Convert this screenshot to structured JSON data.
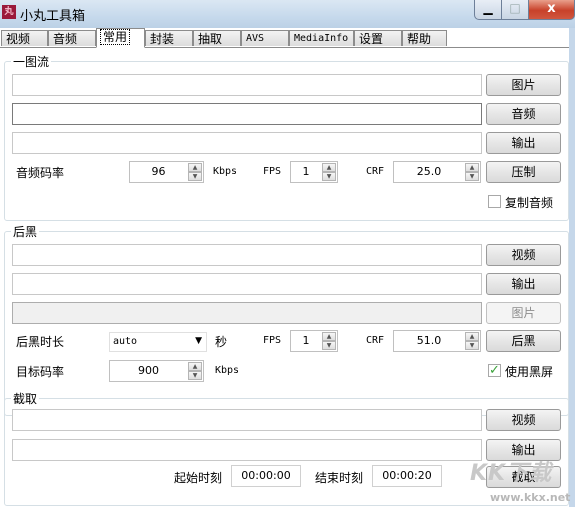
{
  "window": {
    "title": "小丸工具箱",
    "app_icon_glyph": "丸",
    "controls": {
      "minimize": "▁",
      "maximize": "□",
      "close": "x"
    }
  },
  "tabs": [
    {
      "label": "视频",
      "active": false
    },
    {
      "label": "音频",
      "active": false
    },
    {
      "label": "常用",
      "active": true
    },
    {
      "label": "封装",
      "active": false
    },
    {
      "label": "抽取",
      "active": false
    },
    {
      "label": "AVS",
      "active": false
    },
    {
      "label": "MediaInfo",
      "active": false
    },
    {
      "label": "设置",
      "active": false
    },
    {
      "label": "帮助",
      "active": false
    }
  ],
  "one_pic": {
    "title": "一图流",
    "image_path": "",
    "audio_path": "",
    "output_path": "",
    "btn_image": "图片",
    "btn_audio": "音频",
    "btn_output": "输出",
    "audio_bitrate_label": "音频码率",
    "audio_bitrate": "96",
    "kbps_label": "Kbps",
    "fps_label": "FPS",
    "fps": "1",
    "crf_label": "CRF",
    "crf": "25.0",
    "btn_encode": "压制",
    "copy_audio_label": "复制音频",
    "copy_audio_checked": false
  },
  "black": {
    "title": "后黑",
    "video_path": "",
    "output_path": "",
    "image_path": "",
    "btn_video": "视频",
    "btn_output": "输出",
    "btn_image": "图片",
    "duration_label": "后黑时长",
    "duration": "auto",
    "sec_label": "秒",
    "fps_label": "FPS",
    "fps": "1",
    "crf_label": "CRF",
    "crf": "51.0",
    "btn_black": "后黑",
    "target_bitrate_label": "目标码率",
    "target_bitrate": "900",
    "kbps_label": "Kbps",
    "use_black_label": "使用黑屏",
    "use_black_checked": true
  },
  "clip": {
    "title": "截取",
    "video_path": "",
    "output_path": "",
    "btn_video": "视频",
    "btn_output": "输出",
    "start_label": "起始时刻",
    "start_time": "00:00:00",
    "end_label": "结束时刻",
    "end_time": "00:00:20",
    "btn_clip": "截取"
  },
  "watermark": {
    "logo": "KK下载",
    "url": "www.kkx.net"
  }
}
